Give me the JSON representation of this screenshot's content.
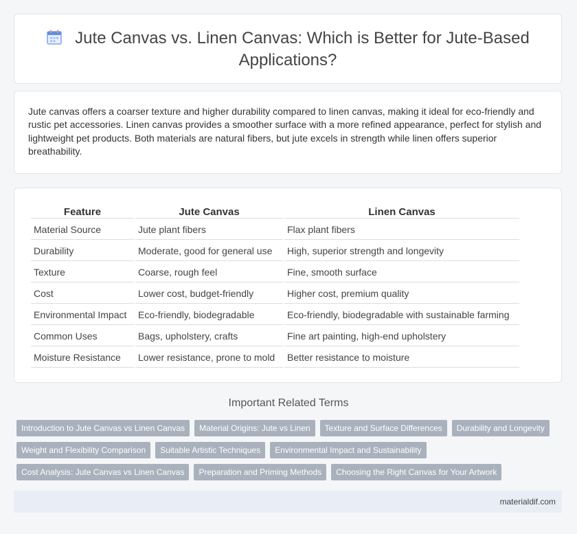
{
  "header": {
    "title": "Jute Canvas vs. Linen Canvas: Which is Better for Jute-Based Applications?",
    "icon": "calendar-icon"
  },
  "summary": {
    "text": "Jute canvas offers a coarser texture and higher durability compared to linen canvas, making it ideal for eco-friendly and rustic pet accessories. Linen canvas provides a smoother surface with a more refined appearance, perfect for stylish and lightweight pet products. Both materials are natural fibers, but jute excels in strength while linen offers superior breathability."
  },
  "table": {
    "headers": [
      "Feature",
      "Jute Canvas",
      "Linen Canvas"
    ],
    "rows": [
      [
        "Material Source",
        "Jute plant fibers",
        "Flax plant fibers"
      ],
      [
        "Durability",
        "Moderate, good for general use",
        "High, superior strength and longevity"
      ],
      [
        "Texture",
        "Coarse, rough feel",
        "Fine, smooth surface"
      ],
      [
        "Cost",
        "Lower cost, budget-friendly",
        "Higher cost, premium quality"
      ],
      [
        "Environmental Impact",
        "Eco-friendly, biodegradable",
        "Eco-friendly, biodegradable with sustainable farming"
      ],
      [
        "Common Uses",
        "Bags, upholstery, crafts",
        "Fine art painting, high-end upholstery"
      ],
      [
        "Moisture Resistance",
        "Lower resistance, prone to mold",
        "Better resistance to moisture"
      ]
    ]
  },
  "related": {
    "title": "Important Related Terms",
    "tags": [
      "Introduction to Jute Canvas vs Linen Canvas",
      "Material Origins: Jute vs Linen",
      "Texture and Surface Differences",
      "Durability and Longevity",
      "Weight and Flexibility Comparison",
      "Suitable Artistic Techniques",
      "Environmental Impact and Sustainability",
      "Cost Analysis: Jute Canvas vs Linen Canvas",
      "Preparation and Priming Methods",
      "Choosing the Right Canvas for Your Artwork"
    ]
  },
  "footer": {
    "site": "materialdif.com"
  },
  "colors": {
    "tag_bg": "#a9b1bd",
    "footer_bg": "#e9edf5",
    "icon_accent": "#5b8ee6"
  }
}
